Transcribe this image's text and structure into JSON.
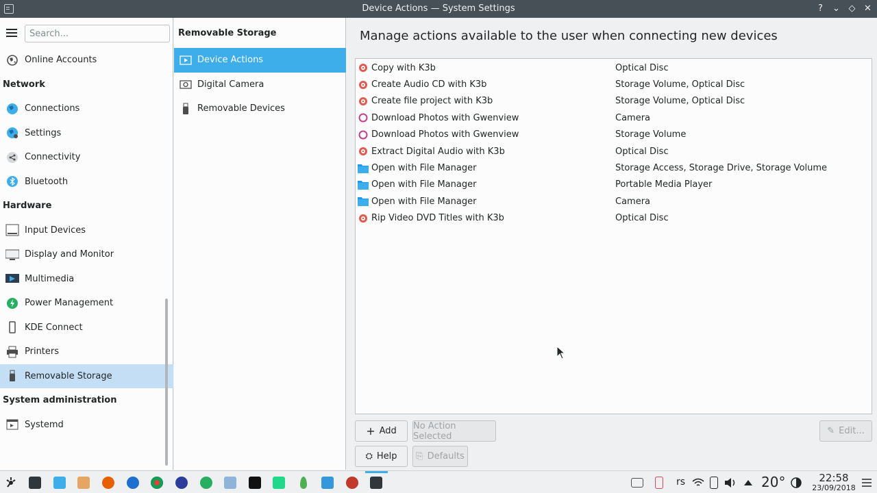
{
  "window": {
    "title": "Device Actions — System Settings",
    "buttons": [
      "?",
      "⌄",
      "◇",
      "✕"
    ]
  },
  "sidebar": {
    "search_placeholder": "Search...",
    "items": [
      {
        "type": "item",
        "label": "Online Accounts",
        "icon": "globe-icon"
      },
      {
        "type": "category",
        "label": "Network"
      },
      {
        "type": "item",
        "label": "Connections",
        "icon": "network-globe-icon"
      },
      {
        "type": "item",
        "label": "Settings",
        "icon": "network-settings-icon"
      },
      {
        "type": "item",
        "label": "Connectivity",
        "icon": "share-icon"
      },
      {
        "type": "item",
        "label": "Bluetooth",
        "icon": "bluetooth-icon"
      },
      {
        "type": "category",
        "label": "Hardware"
      },
      {
        "type": "item",
        "label": "Input Devices",
        "icon": "keyboard-icon"
      },
      {
        "type": "item",
        "label": "Display and Monitor",
        "icon": "monitor-icon"
      },
      {
        "type": "item",
        "label": "Multimedia",
        "icon": "multimedia-icon"
      },
      {
        "type": "item",
        "label": "Power Management",
        "icon": "power-icon"
      },
      {
        "type": "item",
        "label": "KDE Connect",
        "icon": "phone-icon"
      },
      {
        "type": "item",
        "label": "Printers",
        "icon": "printer-icon"
      },
      {
        "type": "item",
        "label": "Removable Storage",
        "icon": "usb-icon",
        "selected": true
      },
      {
        "type": "category",
        "label": "System administration"
      },
      {
        "type": "item",
        "label": "Systemd",
        "icon": "systemd-icon"
      }
    ]
  },
  "subpanel": {
    "header": "Removable Storage",
    "items": [
      {
        "label": "Device Actions",
        "icon": "device-actions-icon",
        "selected": true
      },
      {
        "label": "Digital Camera",
        "icon": "camera-icon"
      },
      {
        "label": "Removable Devices",
        "icon": "usb-icon"
      }
    ]
  },
  "main": {
    "heading": "Manage actions available to the user when connecting new devices",
    "actions": [
      {
        "name": "Copy with K3b",
        "type": "Optical Disc",
        "icon": "k3b-icon"
      },
      {
        "name": "Create Audio CD with K3b",
        "type": "Storage Volume, Optical Disc",
        "icon": "k3b-icon"
      },
      {
        "name": "Create file project with K3b",
        "type": "Storage Volume, Optical Disc",
        "icon": "k3b-icon"
      },
      {
        "name": "Download Photos with Gwenview",
        "type": "Camera",
        "icon": "gwenview-icon"
      },
      {
        "name": "Download Photos with Gwenview",
        "type": "Storage Volume",
        "icon": "gwenview-icon"
      },
      {
        "name": "Extract Digital Audio with K3b",
        "type": "Optical Disc",
        "icon": "k3b-icon"
      },
      {
        "name": "Open with File Manager",
        "type": "Storage Access, Storage Drive, Storage Volume",
        "icon": "folder-icon"
      },
      {
        "name": "Open with File Manager",
        "type": "Portable Media Player",
        "icon": "folder-icon"
      },
      {
        "name": "Open with File Manager",
        "type": "Camera",
        "icon": "folder-icon"
      },
      {
        "name": "Rip Video DVD Titles with K3b",
        "type": "Optical Disc",
        "icon": "k3b-icon"
      }
    ],
    "buttons": {
      "add": "Add",
      "no_action": "No Action Selected",
      "edit": "Edit...",
      "help": "Help",
      "defaults": "Defaults"
    }
  },
  "taskbar": {
    "keyboard_layout": "rs",
    "temperature": "20°",
    "time": "22:58",
    "date": "23/09/2018",
    "accent": "#3daee9"
  }
}
